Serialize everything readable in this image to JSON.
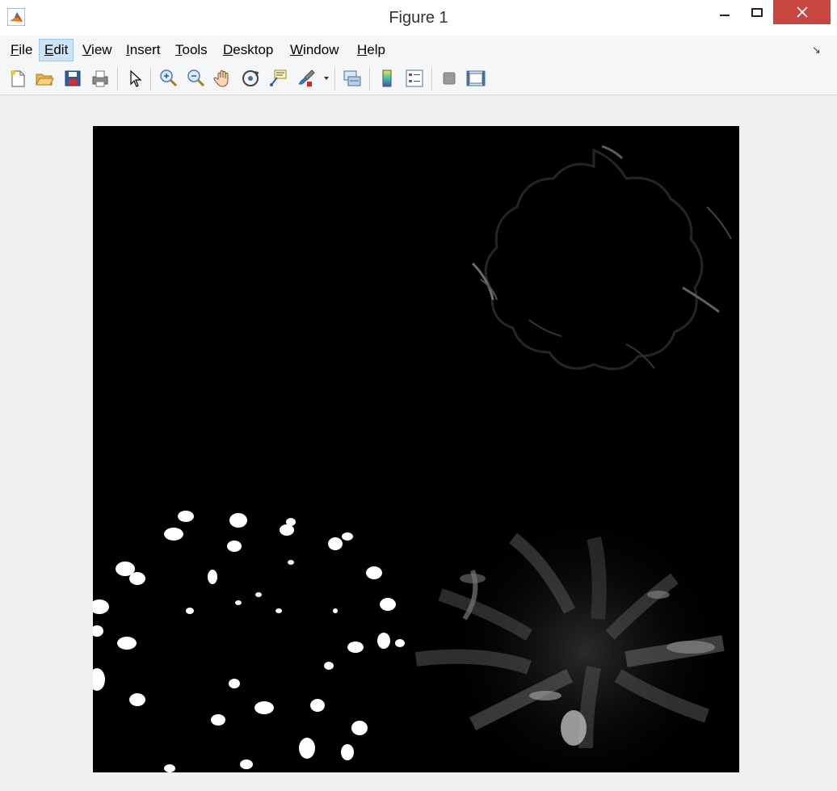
{
  "window": {
    "title": "Figure 1",
    "app_icon": "matlab-icon",
    "controls": [
      "minimize-icon",
      "maximize-icon",
      "close-icon"
    ]
  },
  "menubar": {
    "items": [
      {
        "label": "File",
        "mnemonic": "F",
        "rest": "ile"
      },
      {
        "label": "Edit",
        "mnemonic": "E",
        "rest": "dit"
      },
      {
        "label": "View",
        "mnemonic": "V",
        "rest": "iew"
      },
      {
        "label": "Insert",
        "mnemonic": "I",
        "rest": "nsert"
      },
      {
        "label": "Tools",
        "mnemonic": "T",
        "rest": "ools"
      },
      {
        "label": "Desktop",
        "mnemonic": "D",
        "rest": "esktop"
      },
      {
        "label": "Window",
        "mnemonic": "W",
        "rest": "indow"
      },
      {
        "label": "Help",
        "mnemonic": "H",
        "rest": "elp"
      }
    ],
    "active_item": "Edit"
  },
  "toolbar": {
    "buttons": [
      "new-figure-icon",
      "open-file-icon",
      "save-icon",
      "print-icon",
      "edit-plot-arrow-icon",
      "zoom-in-icon",
      "zoom-out-icon",
      "pan-hand-icon",
      "rotate-3d-icon",
      "data-cursor-icon",
      "brush-icon",
      "link-plot-icon",
      "insert-colorbar-icon",
      "insert-legend-icon",
      "hide-plot-tools-icon",
      "show-plot-tools-icon"
    ]
  },
  "colors": {
    "titlebar_bg": "#ffffff",
    "close_button_bg": "#c7463f",
    "menu_active_bg": "#cce4f7",
    "figure_bg": "#f0f0f0",
    "image_bg": "#000000"
  },
  "figure": {
    "content": "grayscale-image-flowers"
  }
}
